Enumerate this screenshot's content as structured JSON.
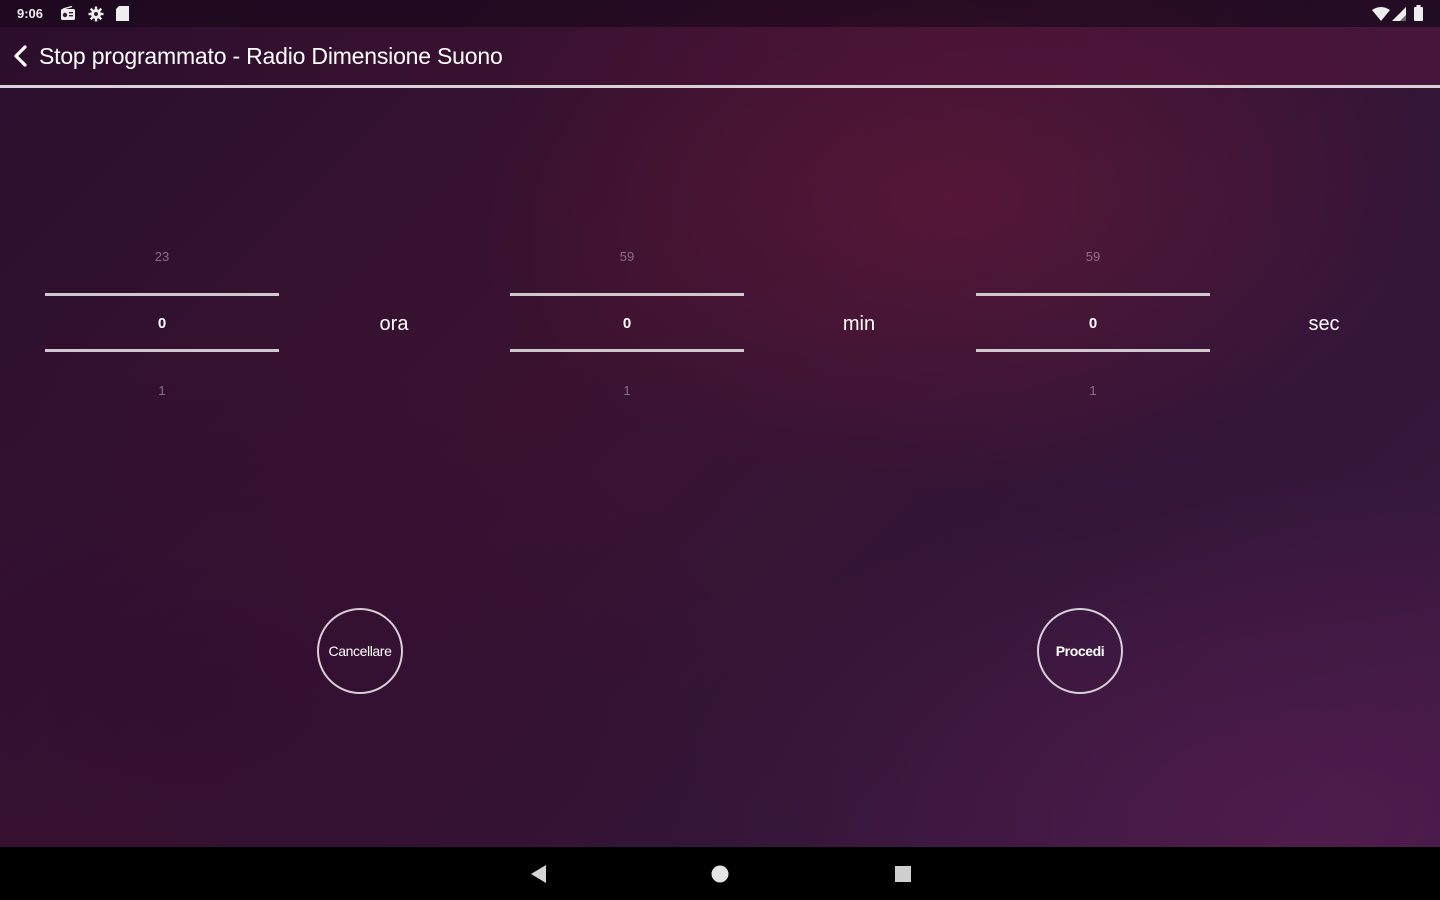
{
  "status_bar": {
    "time": "9:06",
    "icons": [
      "radio-icon",
      "gear-icon",
      "sd-card-icon",
      "wifi-icon",
      "signal-icon",
      "battery-icon"
    ]
  },
  "header": {
    "title": "Stop programmato - Radio Dimensione Suono",
    "back_icon": "chevron-left-icon"
  },
  "pickers": [
    {
      "prev": "23",
      "value": "0",
      "next": "1",
      "unit": "ora"
    },
    {
      "prev": "59",
      "value": "0",
      "next": "1",
      "unit": "min"
    },
    {
      "prev": "59",
      "value": "0",
      "next": "1",
      "unit": "sec"
    }
  ],
  "actions": {
    "cancel_label": "Cancellare",
    "proceed_label": "Procedi"
  },
  "nav_bar": {
    "icons": [
      "back-triangle-icon",
      "home-circle-icon",
      "recents-square-icon"
    ]
  },
  "colors": {
    "accent_line": "#d8d2d8",
    "background_start": "#2a0f2e",
    "background_end": "#3d1a44"
  }
}
